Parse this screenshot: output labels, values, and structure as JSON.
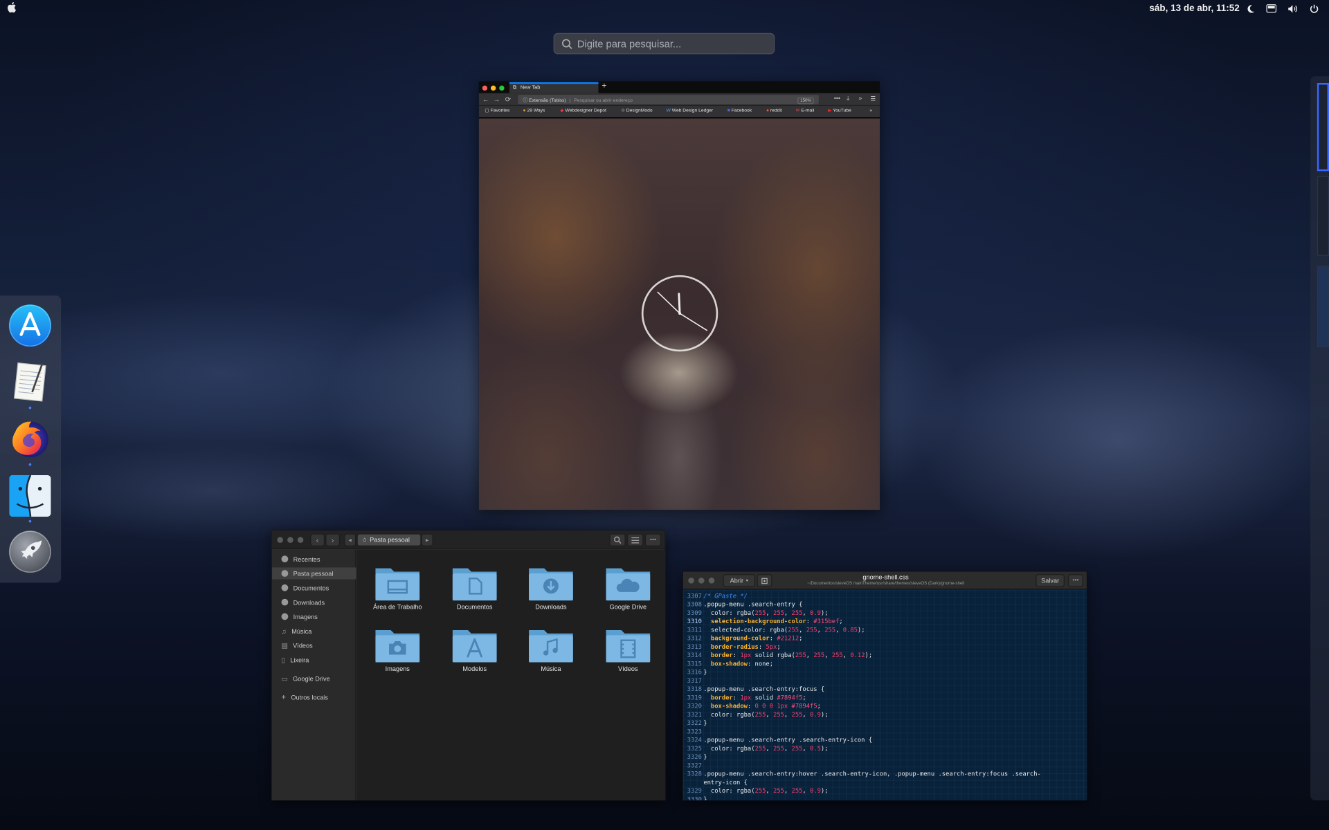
{
  "topbar": {
    "apple_icon": "apple-logo",
    "datetime": "sáb, 13 de abr, 11:52",
    "tray_icons": [
      "moon-icon",
      "battery-icon",
      "volume-icon",
      "power-icon"
    ]
  },
  "search": {
    "placeholder": "Digite para pesquisar..."
  },
  "dock": {
    "apps": [
      {
        "name": "App Store",
        "icon": "app-store-icon",
        "running": false
      },
      {
        "name": "Text Editor",
        "icon": "text-editor-icon",
        "running": true
      },
      {
        "name": "Firefox",
        "icon": "firefox-icon",
        "running": true
      },
      {
        "name": "Files",
        "icon": "finder-icon",
        "running": true
      },
      {
        "name": "Launchpad",
        "icon": "launchpad-icon",
        "running": false
      }
    ]
  },
  "firefox": {
    "tab_title": "New Tab",
    "url_extension_label": "Extensão (Tobiss)",
    "url_placeholder": "Pesquisar ou abrir endereço",
    "zoom": "150%",
    "bookmarks": [
      "Favorites",
      "29 Ways",
      "Webdesigner Depot",
      "DesignModo",
      "Web Design Ledger",
      "Facebook",
      "reddit",
      "E-mail",
      "YouTube"
    ]
  },
  "files": {
    "breadcrumb": "Pasta pessoal",
    "sidebar": [
      {
        "label": "Recentes",
        "icon": "clock-icon",
        "active": false
      },
      {
        "label": "Pasta pessoal",
        "icon": "home-icon",
        "active": true
      },
      {
        "label": "Documentos",
        "icon": "document-icon",
        "active": false
      },
      {
        "label": "Downloads",
        "icon": "download-icon",
        "active": false
      },
      {
        "label": "Imagens",
        "icon": "image-icon",
        "active": false
      },
      {
        "label": "Música",
        "icon": "music-icon",
        "active": false
      },
      {
        "label": "Vídeos",
        "icon": "video-icon",
        "active": false
      },
      {
        "label": "Lixeira",
        "icon": "trash-icon",
        "active": false
      },
      {
        "label": "Google Drive",
        "icon": "drive-icon",
        "active": false
      },
      {
        "label": "Outros locais",
        "icon": "plus-icon",
        "active": false
      }
    ],
    "folders": [
      {
        "label": "Área de Trabalho",
        "icon": "desktop-folder-icon"
      },
      {
        "label": "Documentos",
        "icon": "documents-folder-icon"
      },
      {
        "label": "Downloads",
        "icon": "downloads-folder-icon"
      },
      {
        "label": "Google Drive",
        "icon": "cloud-folder-icon"
      },
      {
        "label": "Imagens",
        "icon": "camera-folder-icon"
      },
      {
        "label": "Modelos",
        "icon": "templates-folder-icon"
      },
      {
        "label": "Música",
        "icon": "music-folder-icon"
      },
      {
        "label": "Vídeos",
        "icon": "video-folder-icon"
      }
    ]
  },
  "editor": {
    "open_label": "Abrir",
    "file_name": "gnome-shell.css",
    "file_path": "~/Documentos/steveOS mainTheme/usr/share/themes/steveOS (Dark)/gnome-shell",
    "save_label": "Salvar",
    "lines": [
      {
        "n": "3307",
        "text": "/* GPaste */"
      },
      {
        "n": "3308",
        "text": ".popup-menu .search-entry {"
      },
      {
        "n": "3309",
        "text": "  color: rgba(255, 255, 255, 0.9);"
      },
      {
        "n": "3310",
        "text": "  selection-background-color: #315bef;"
      },
      {
        "n": "3311",
        "text": "  selected-color: rgba(255, 255, 255, 0.85);"
      },
      {
        "n": "3312",
        "text": "  background-color: #21212;"
      },
      {
        "n": "3313",
        "text": "  border-radius: 5px;"
      },
      {
        "n": "3314",
        "text": "  border: 1px solid rgba(255, 255, 255, 0.12);"
      },
      {
        "n": "3315",
        "text": "  box-shadow: none;"
      },
      {
        "n": "3316",
        "text": "}"
      },
      {
        "n": "3317",
        "text": ""
      },
      {
        "n": "3318",
        "text": ".popup-menu .search-entry:focus {"
      },
      {
        "n": "3319",
        "text": "  border: 1px solid #7894f5;"
      },
      {
        "n": "3320",
        "text": "  box-shadow: 0 0 0 1px #7894f5;"
      },
      {
        "n": "3321",
        "text": "  color: rgba(255, 255, 255, 0.9);"
      },
      {
        "n": "3322",
        "text": "}"
      },
      {
        "n": "3323",
        "text": ""
      },
      {
        "n": "3324",
        "text": ".popup-menu .search-entry .search-entry-icon {"
      },
      {
        "n": "3325",
        "text": "  color: rgba(255, 255, 255, 0.5);"
      },
      {
        "n": "3326",
        "text": "}"
      },
      {
        "n": "3327",
        "text": ""
      },
      {
        "n": "3328",
        "text": ".popup-menu .search-entry:hover .search-entry-icon, .popup-menu .search-entry:focus .search-"
      },
      {
        "n": "",
        "text": "entry-icon {"
      },
      {
        "n": "3329",
        "text": "  color: rgba(255, 255, 255, 0.9);"
      },
      {
        "n": "3330",
        "text": "}"
      }
    ]
  }
}
